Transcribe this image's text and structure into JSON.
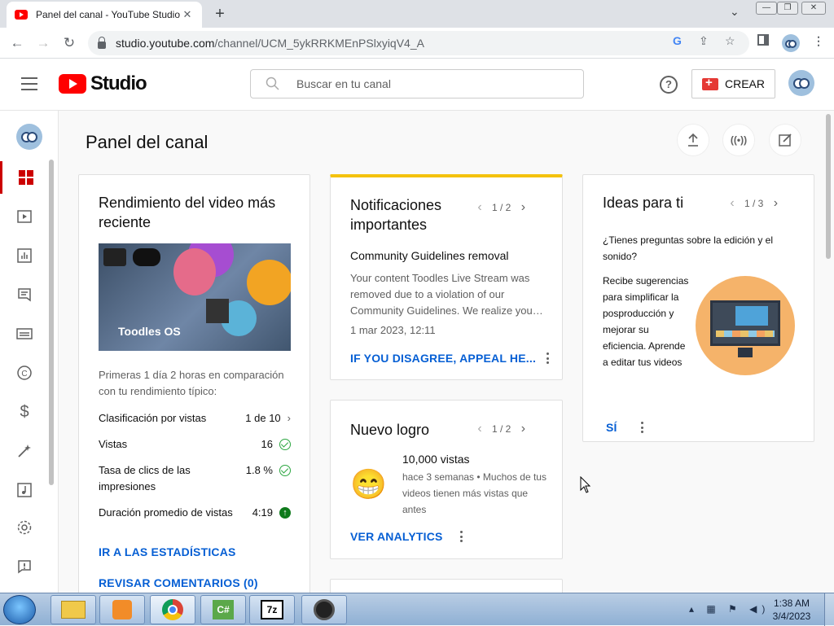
{
  "browser": {
    "tab_title": "Panel del canal - YouTube Studio",
    "url_host": "studio.youtube.com",
    "url_path": "/channel/UCM_5ykRRKMEnPSlxyiqV4_A"
  },
  "header": {
    "logo_text": "Studio",
    "search_placeholder": "Buscar en tu canal",
    "help_label": "?",
    "create_label": "CREAR"
  },
  "sidebar": {
    "items": [
      "dashboard-icon",
      "content-icon",
      "analytics-icon",
      "comments-icon",
      "subtitles-icon",
      "copyright-icon",
      "earn-icon",
      "customization-icon",
      "audio-library-icon",
      "settings-icon",
      "feedback-icon"
    ]
  },
  "page": {
    "title": "Panel del canal"
  },
  "latest_video": {
    "title": "Rendimiento del video más reciente",
    "thumbnail_label": "Toodles OS",
    "comparison_text": "Primeras 1 día 2 horas en comparación con tu rendimiento típico:",
    "stats": [
      {
        "label": "Clasificación por vistas",
        "value": "1 de 10"
      },
      {
        "label": "Vistas",
        "value": "16"
      },
      {
        "label": "Tasa de clics de las impresiones",
        "value": "1.8 %"
      },
      {
        "label": "Duración promedio de vistas",
        "value": "4:19"
      }
    ],
    "analytics_link": "IR A LAS ESTADÍSTICAS",
    "comments_link": "REVISAR COMENTARIOS (0)"
  },
  "notifications": {
    "title": "Notificaciones importantes",
    "pager": "1 / 2",
    "item_title": "Community Guidelines removal",
    "item_body": "Your content Toodles Live Stream was removed due to a violation of our Community Guidelines. We realize you…",
    "item_date": "1 mar 2023, 12:11",
    "action": "IF YOU DISAGREE, APPEAL HE..."
  },
  "achievement": {
    "title": "Nuevo logro",
    "pager": "1 / 2",
    "emoji": "😁",
    "headline": "10,000 vistas",
    "body": "hace 3 semanas • Muchos de tus videos tienen más vistas que antes",
    "action": "VER ANALYTICS"
  },
  "ideas": {
    "title": "Ideas para ti",
    "pager": "1 / 3",
    "question": "¿Tienes preguntas sobre la edición y el sonido?",
    "body": "Recibe sugerencias para simplificar la posproducción y mejorar su eficiencia. Aprende a editar tus videos",
    "action": "SÍ"
  },
  "taskbar": {
    "time": "1:38 AM",
    "date": "3/4/2023",
    "apps": [
      "file-explorer-icon",
      "media-player-icon",
      "chrome-icon",
      "csharp-icon",
      "7zip-icon",
      "obs-icon"
    ]
  },
  "colors": {
    "youtube_red": "#ff0000",
    "link_blue": "#065fd4",
    "notif_accent": "#f4c20d",
    "success_green": "#2ba640"
  }
}
